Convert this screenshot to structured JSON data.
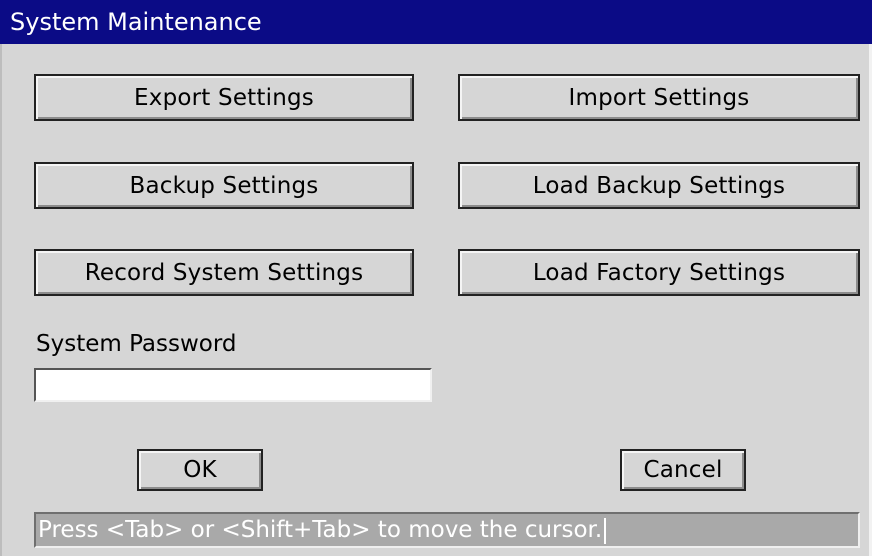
{
  "window": {
    "title": "System Maintenance"
  },
  "buttons": {
    "export_settings": "Export Settings",
    "import_settings": "Import Settings",
    "backup_settings": "Backup Settings",
    "load_backup_settings": "Load Backup Settings",
    "record_system_settings": "Record System Settings",
    "load_factory_settings": "Load Factory Settings",
    "ok": "OK",
    "cancel": "Cancel"
  },
  "password": {
    "label": "System Password",
    "value": "",
    "placeholder": ""
  },
  "status": {
    "text": "Press <Tab> or <Shift+Tab> to move the cursor."
  },
  "colors": {
    "titlebar": "#0b0b86",
    "background": "#d6d6d6",
    "statusbar": "#a9a9a9"
  }
}
